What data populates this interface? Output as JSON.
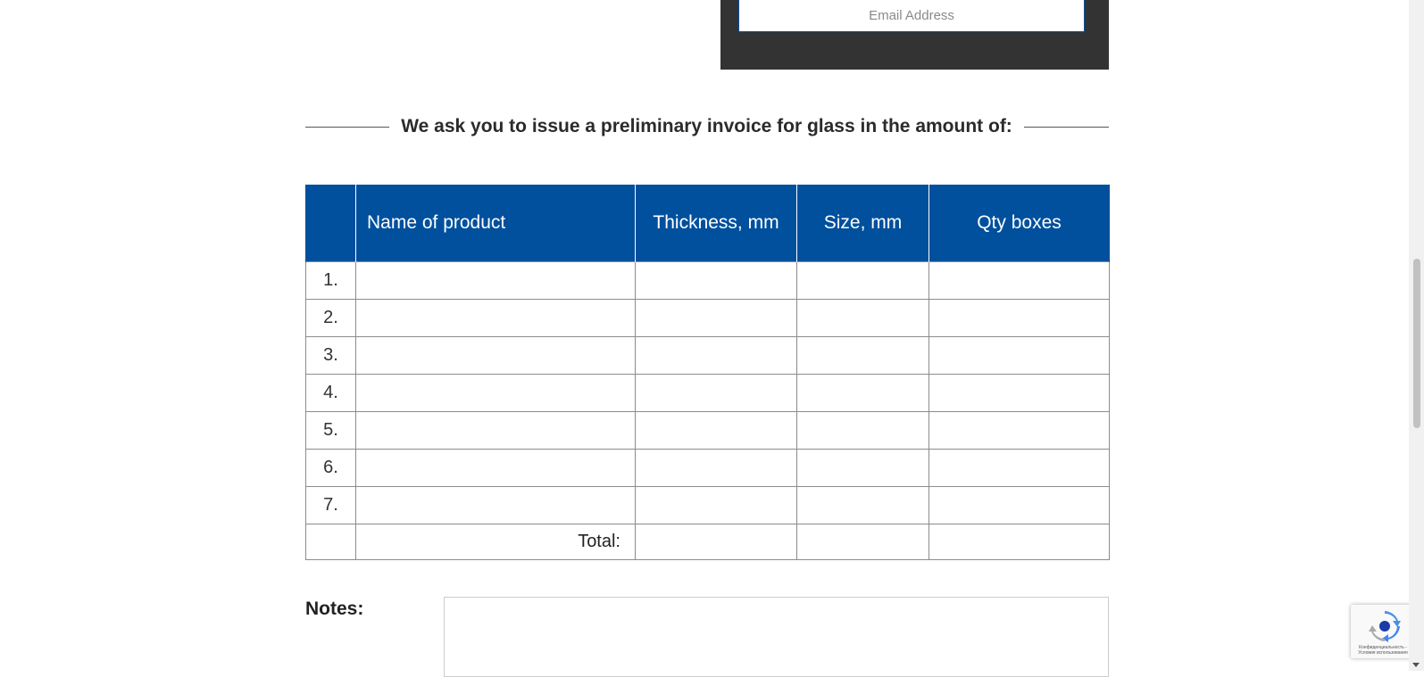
{
  "subscribe": {
    "email_placeholder": "Email Address"
  },
  "section": {
    "heading": "We ask you to issue a preliminary invoice for glass in the amount of:"
  },
  "order_table": {
    "headers": [
      "",
      "Name of product",
      "Thickness, mm",
      "Size, mm",
      "Qty boxes"
    ],
    "rows": [
      {
        "num": "1."
      },
      {
        "num": "2."
      },
      {
        "num": "3."
      },
      {
        "num": "4."
      },
      {
        "num": "5."
      },
      {
        "num": "6."
      },
      {
        "num": "7."
      }
    ],
    "total_label": "Total:"
  },
  "notes": {
    "label": "Notes:"
  },
  "recaptcha": {
    "text": "Конфиденциальность - Условия использования"
  },
  "colors": {
    "header_blue": "#00509d",
    "panel_dark": "#333333"
  }
}
